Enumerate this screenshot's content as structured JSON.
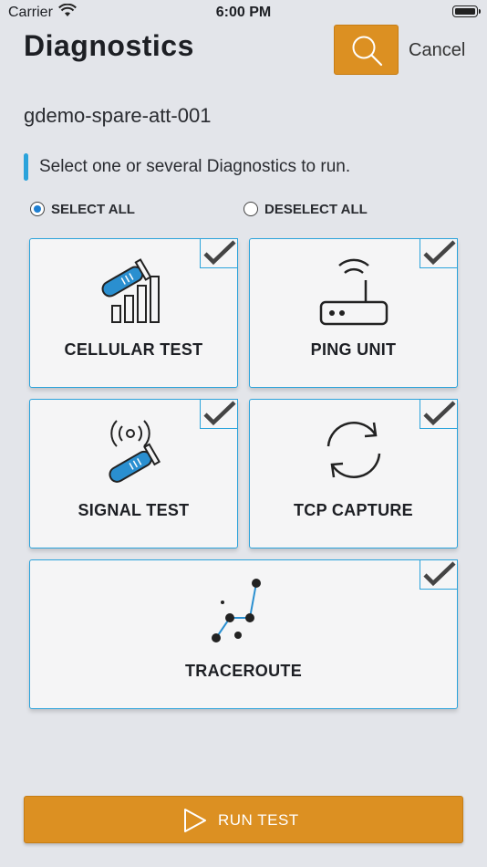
{
  "status_bar": {
    "carrier": "Carrier",
    "time": "6:00 PM"
  },
  "header": {
    "title": "Diagnostics",
    "cancel_label": "Cancel"
  },
  "device_name": "gdemo-spare-att-001",
  "instruction": "Select one or several Diagnostics to run.",
  "selection": {
    "select_all": "SELECT ALL",
    "deselect_all": "DESELECT ALL",
    "selected": "SELECT ALL"
  },
  "tests": [
    {
      "label": "CELLULAR TEST",
      "icon": "cellular-test-icon",
      "checked": true
    },
    {
      "label": "PING UNIT",
      "icon": "router-icon",
      "checked": true
    },
    {
      "label": "SIGNAL TEST",
      "icon": "signal-test-icon",
      "checked": true
    },
    {
      "label": "TCP CAPTURE",
      "icon": "refresh-cycle-icon",
      "checked": true
    },
    {
      "label": "TRACEROUTE",
      "icon": "traceroute-icon",
      "checked": true
    }
  ],
  "run_button": {
    "label": "RUN TEST"
  },
  "colors": {
    "accent": "#2ba3db",
    "primary_button": "#dc9022",
    "background": "#e3e5ea",
    "tube": "#2a8fd0"
  }
}
